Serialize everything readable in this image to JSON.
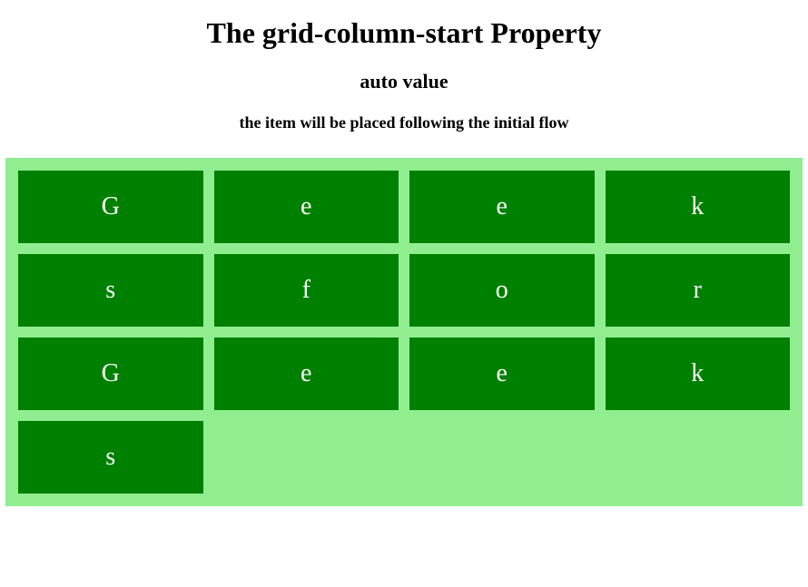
{
  "title": "The grid-column-start Property",
  "subtitle": "auto value",
  "description": "the item will be placed following the initial flow",
  "grid": {
    "items": [
      "G",
      "e",
      "e",
      "k",
      "s",
      "f",
      "o",
      "r",
      "G",
      "e",
      "e",
      "k",
      "s"
    ]
  }
}
